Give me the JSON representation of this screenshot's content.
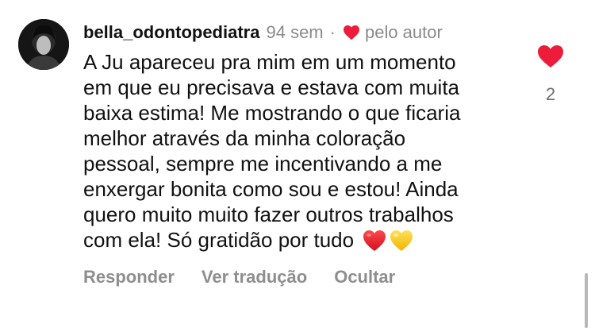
{
  "comment": {
    "username": "bella_odontopediatra",
    "time": "94 sem",
    "separator": "·",
    "liked_by_author_label": "pelo autor",
    "text_lines": [
      "A Ju apareceu pra mim em um momento",
      "em que eu precisava e estava com muita",
      "baixa estima! Me mostrando o que ficaria",
      "melhor através da minha coloração",
      "pessoal, sempre me incentivando a me",
      "enxergar bonita como sou e estou! Ainda",
      "quero muito muito fazer outros trabalhos",
      "com ela! Só gratidão por tudo"
    ],
    "emojis": [
      "red-heart",
      "yellow-heart"
    ],
    "like_count": "2",
    "liked": true
  },
  "actions": {
    "reply": "Responder",
    "translate": "Ver tradução",
    "hide": "Ocultar"
  },
  "colors": {
    "heart_red": "#ed1c3a",
    "yellow_heart": "#f8c62c",
    "muted_text": "#8e8e8e"
  }
}
